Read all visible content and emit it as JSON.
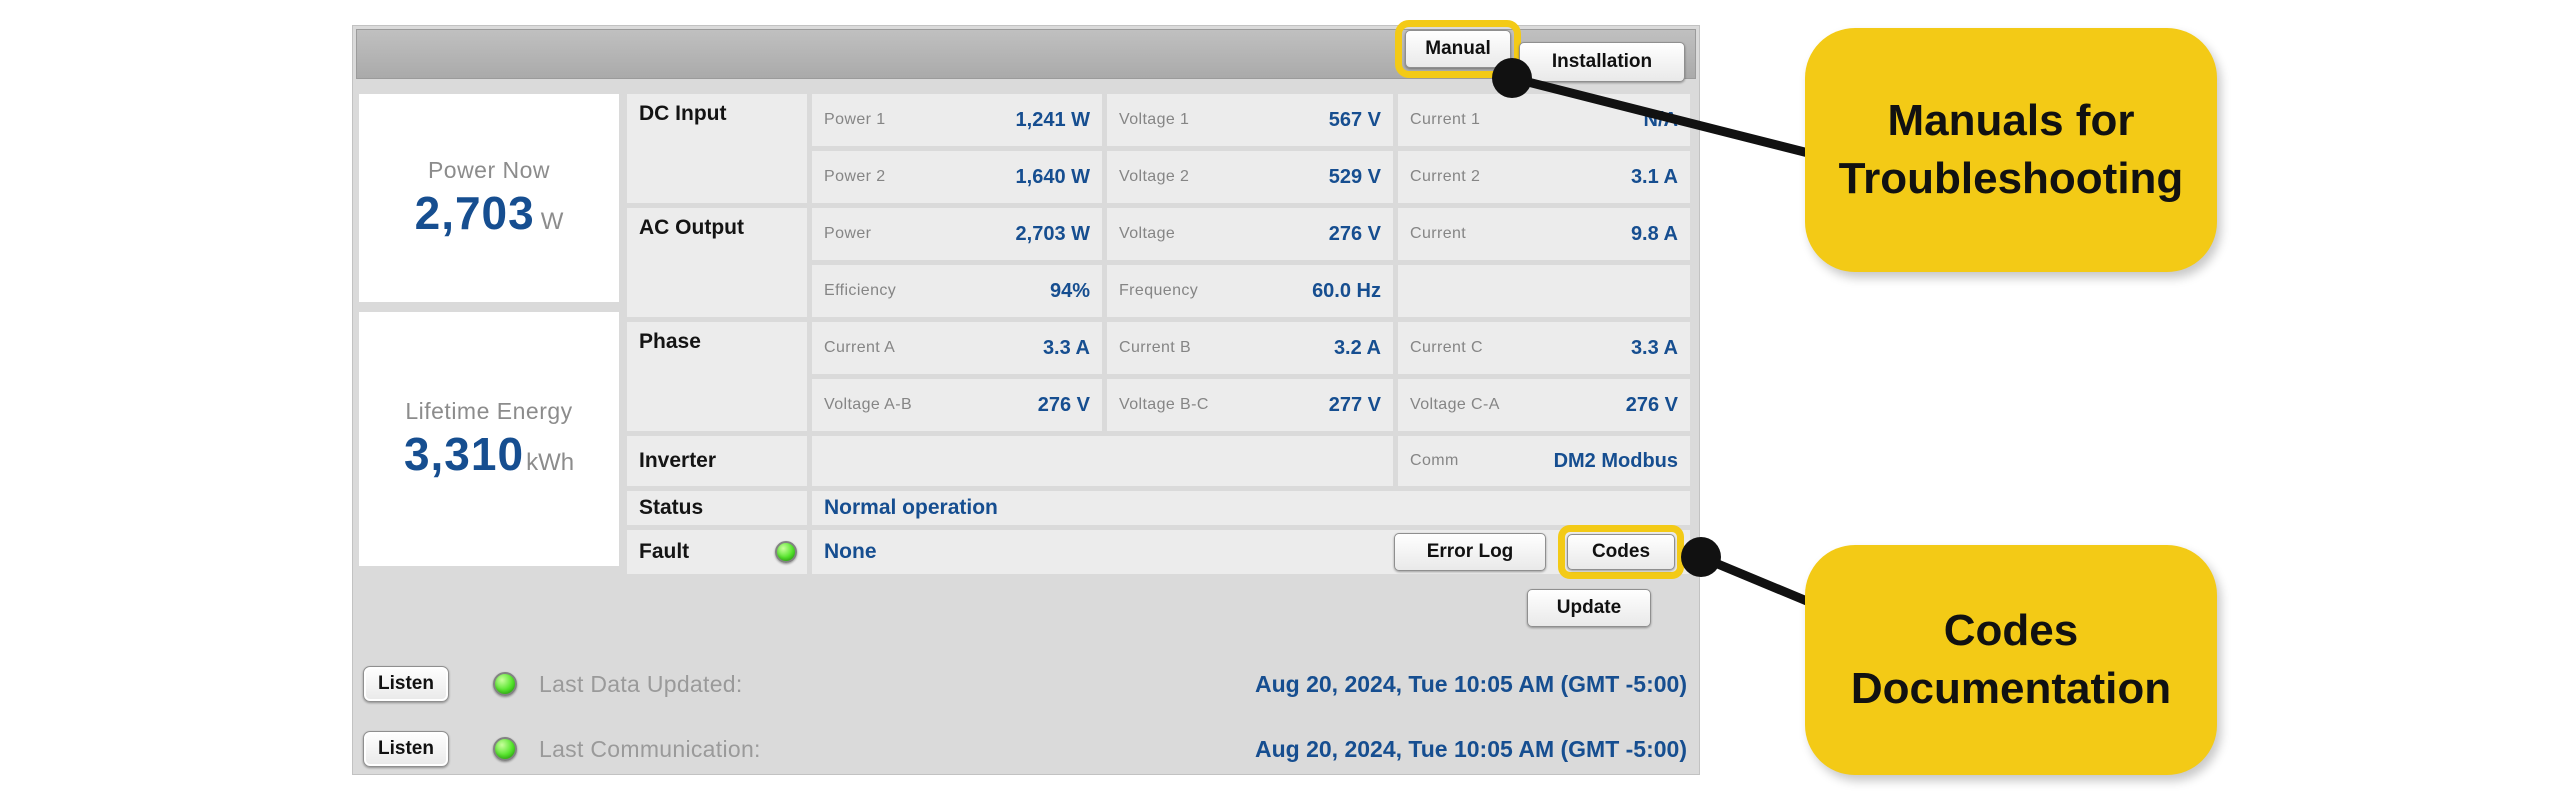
{
  "colors": {
    "accent_blue": "#164E90",
    "highlight_yellow": "#F3CA16",
    "led_green": "#44DD22",
    "panel_gray": "#DADADA"
  },
  "header": {
    "manual": "Manual",
    "installation": "Installation"
  },
  "summary": {
    "power_now": {
      "label": "Power Now",
      "value": "2,703",
      "unit": "W"
    },
    "lifetime_energy": {
      "label": "Lifetime Energy",
      "value": "3,310",
      "unit": "kWh"
    }
  },
  "table": {
    "dc": {
      "label": "DC Input",
      "r1": [
        {
          "l": "Power 1",
          "v": "1,241 W"
        },
        {
          "l": "Voltage 1",
          "v": "567 V"
        },
        {
          "l": "Current 1",
          "v": "N/A"
        }
      ],
      "r2": [
        {
          "l": "Power 2",
          "v": "1,640 W"
        },
        {
          "l": "Voltage 2",
          "v": "529 V"
        },
        {
          "l": "Current 2",
          "v": "3.1 A"
        }
      ]
    },
    "ac": {
      "label": "AC Output",
      "r1": [
        {
          "l": "Power",
          "v": "2,703 W"
        },
        {
          "l": "Voltage",
          "v": "276 V"
        },
        {
          "l": "Current",
          "v": "9.8 A"
        }
      ],
      "r2": [
        {
          "l": "Efficiency",
          "v": "94%"
        },
        {
          "l": "Frequency",
          "v": "60.0 Hz"
        }
      ]
    },
    "phase": {
      "label": "Phase",
      "r1": [
        {
          "l": "Current A",
          "v": "3.3 A"
        },
        {
          "l": "Current B",
          "v": "3.2 A"
        },
        {
          "l": "Current C",
          "v": "3.3 A"
        }
      ],
      "r2": [
        {
          "l": "Voltage A-B",
          "v": "276 V"
        },
        {
          "l": "Voltage B-C",
          "v": "277 V"
        },
        {
          "l": "Voltage C-A",
          "v": "276 V"
        }
      ]
    },
    "inverter": {
      "label": "Inverter",
      "comm_label": "Comm",
      "comm_value": "DM2 Modbus"
    },
    "status": {
      "label": "Status",
      "value": "Normal operation"
    },
    "fault": {
      "label": "Fault",
      "value": "None",
      "error_log": "Error Log",
      "codes": "Codes"
    }
  },
  "footer": {
    "update": "Update",
    "rows": [
      {
        "button": "Listen",
        "label": "Last Data Updated:",
        "value": "Aug 20, 2024, Tue 10:05 AM (GMT -5:00)"
      },
      {
        "button": "Listen",
        "label": "Last Communication:",
        "value": "Aug 20, 2024, Tue 10:05 AM (GMT -5:00)"
      }
    ]
  },
  "annotations": {
    "manual_callout": {
      "line1": "Manuals for",
      "line2": "Troubleshooting"
    },
    "codes_callout": {
      "line1": "Codes",
      "line2": "Documentation"
    }
  },
  "icons": {
    "fault_led": "green-led",
    "listen_led": "green-led"
  }
}
